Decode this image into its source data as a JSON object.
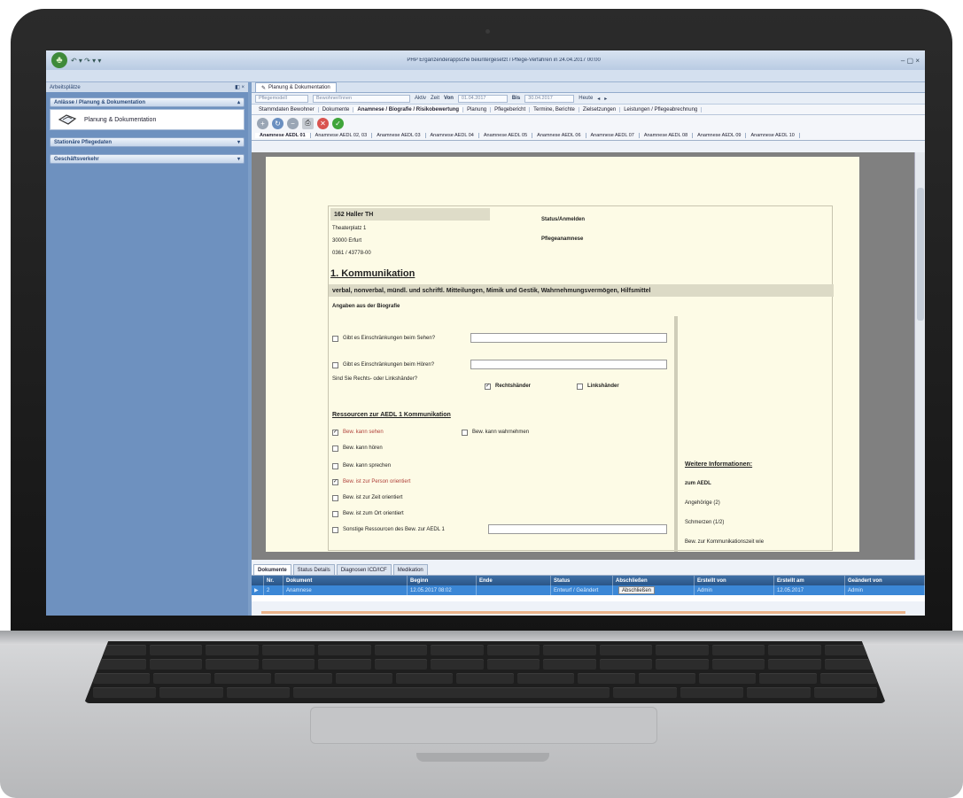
{
  "window": {
    "title": "PHP Ergänzenderappsche beiuntergesetzt / Pflege-Verfahren in 24.04.2017 00:00",
    "quick_access": "↶ ▾ ↷ ▾ ▾",
    "controls": "– ▢ ×"
  },
  "nav": {
    "header": "Arbeitsplätze",
    "header_controls": "◧ ×",
    "sections": [
      {
        "label": "Anlässe / Planung & Dokumentation",
        "arrow": "▴"
      },
      {
        "label": "Stationäre Pflegedaten",
        "arrow": "▾"
      },
      {
        "label": "Geschäftsverkehr",
        "arrow": "▾"
      }
    ],
    "item_label": "Planung & Dokumentation"
  },
  "content": {
    "doc_tab": "Planung & Dokumentation",
    "filters": {
      "box1": "Pflegemodell",
      "box2": "Bewohner/Innen",
      "label_aktiv": "Aktiv",
      "label_zeit": "Zeit",
      "label_von": "Von",
      "date_from": "01.04.2017",
      "label_bis": "Bis",
      "date_to": "30.04.2017",
      "label_heute": "Heute"
    },
    "subtabs": [
      "Stammdaten Bewohner",
      "Dokumente",
      "Anamnese / Biografie / Risikobewertung",
      "Planung",
      "Pflegebericht",
      "Termine, Berichte",
      "Zielsetzungen",
      "Leistungen / Pflegeabrechnung"
    ],
    "aedl_tabs": [
      "Anamnese AEDL 01",
      "Anamnese AEDL 02, 03",
      "Anamnese AEDL 03",
      "Anamnese AEDL 04",
      "Anamnese AEDL 05",
      "Anamnese AEDL 06",
      "Anamnese AEDL 07",
      "Anamnese AEDL 08",
      "Anamnese AEDL 09",
      "Anamnese AEDL 10"
    ]
  },
  "form": {
    "resident_name": "162 Haller TH",
    "address_line1": "Theaterplatz 1",
    "address_line2": "30000    Erfurt",
    "phone": "0361 / 43778-00",
    "label_status": "Status/Anmelden",
    "label_pflege": "Pflegeanamnese",
    "section_title": "1. Kommunikation",
    "section_bar": "verbal, nonverbal, mündl. und schriftl. Mitteilungen, Mimik und Gestik, Wahrnehmungsvermögen, Hilfsmittel",
    "biografie_heading": "Angaben aus der Biografie",
    "q_sehen": "Gibt es Einschränkungen beim Sehen?",
    "q_hoeren": "Gibt es Einschränkungen beim Hören?",
    "q_haendig": "Sind Sie Rechts- oder Linkshänder?",
    "opt_rechts": "Rechtshänder",
    "opt_links": "Linkshänder",
    "ressourcen_heading": "Ressourcen zur AEDL 1 Kommunikation",
    "r1": "Bew. kann sehen",
    "r1b": "Bew. kann wahrnehmen",
    "r2": "Bew. kann hören",
    "r3": "Bew. kann sprechen",
    "r4": "Bew. ist zur Person orientiert",
    "r5": "Bew. ist zur Zeit orientiert",
    "r6": "Bew. ist zum Ort orientiert",
    "r7": "Sonstige Ressourcen des Bew. zur AEDL 1",
    "weitere_heading": "Weitere Informationen:",
    "w1": "zum AEDL",
    "w2": "Angehörige (2)",
    "w3": "Schmerzen (1/2)",
    "w4": "Bew. zur Kommunikationszeit wie"
  },
  "bottom": {
    "tabs": [
      "Dokumente",
      "Status Details",
      "Diagnosen ICD/ICF",
      "Medikation"
    ],
    "columns": [
      "",
      "Nr.",
      "Dokument",
      "Beginn",
      "Ende",
      "Status",
      "Abschließen",
      "Erstellt von",
      "Erstellt am",
      "Geändert von"
    ],
    "row": [
      "▶",
      "2",
      "Anamnese",
      "12.05.2017 08:02",
      "",
      "Entwurf / Geändert",
      "Abschließen",
      "Admin",
      "12.05.2017",
      "Admin"
    ]
  },
  "colors": {
    "accent": "#3b87d6",
    "nav_bg": "#6e91bf",
    "paper": "#fdfbe6",
    "header_row": "#2a5587"
  }
}
